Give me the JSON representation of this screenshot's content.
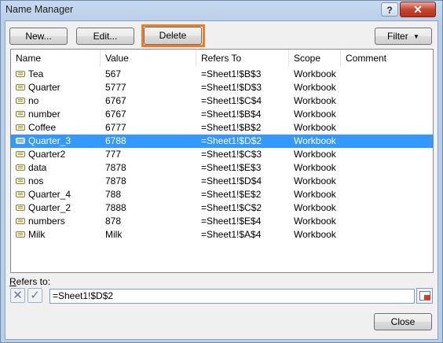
{
  "window": {
    "title": "Name Manager",
    "help_label": "?",
    "close_label": "✕"
  },
  "toolbar": {
    "new_label": "New...",
    "edit_label": "Edit...",
    "delete_label": "Delete",
    "filter_label": "Filter"
  },
  "columns": [
    "Name",
    "Value",
    "Refers To",
    "Scope",
    "Comment"
  ],
  "rows": [
    {
      "name": "Tea",
      "value": "567",
      "refers_to": "=Sheet1!$B$3",
      "scope": "Workbook",
      "comment": ""
    },
    {
      "name": "Quarter",
      "value": "5777",
      "refers_to": "=Sheet1!$D$3",
      "scope": "Workbook",
      "comment": ""
    },
    {
      "name": "no",
      "value": "6767",
      "refers_to": "=Sheet1!$C$4",
      "scope": "Workbook",
      "comment": ""
    },
    {
      "name": "number",
      "value": "6767",
      "refers_to": "=Sheet1!$B$4",
      "scope": "Workbook",
      "comment": ""
    },
    {
      "name": "Coffee",
      "value": "6777",
      "refers_to": "=Sheet1!$B$2",
      "scope": "Workbook",
      "comment": ""
    },
    {
      "name": "Quarter_3",
      "value": "6788",
      "refers_to": "=Sheet1!$D$2",
      "scope": "Workbook",
      "comment": "",
      "selected": true
    },
    {
      "name": "Quarter2",
      "value": "777",
      "refers_to": "=Sheet1!$C$3",
      "scope": "Workbook",
      "comment": ""
    },
    {
      "name": "data",
      "value": "7878",
      "refers_to": "=Sheet1!$E$3",
      "scope": "Workbook",
      "comment": ""
    },
    {
      "name": "nos",
      "value": "7878",
      "refers_to": "=Sheet1!$D$4",
      "scope": "Workbook",
      "comment": ""
    },
    {
      "name": "Quarter_4",
      "value": "788",
      "refers_to": "=Sheet1!$E$2",
      "scope": "Workbook",
      "comment": ""
    },
    {
      "name": "Quarter_2",
      "value": "7888",
      "refers_to": "=Sheet1!$C$2",
      "scope": "Workbook",
      "comment": ""
    },
    {
      "name": "numbers",
      "value": "878",
      "refers_to": "=Sheet1!$E$4",
      "scope": "Workbook",
      "comment": ""
    },
    {
      "name": "Milk",
      "value": "Milk",
      "refers_to": "=Sheet1!$A$4",
      "scope": "Workbook",
      "comment": ""
    }
  ],
  "refers_to": {
    "label": "Refers to:",
    "value": "=Sheet1!$D$2",
    "cancel_icon": "cancel-x-icon",
    "confirm_icon": "checkmark-icon"
  },
  "footer": {
    "close_label": "Close"
  },
  "colors": {
    "selection": "#3399ff",
    "highlight": "#f07d24"
  }
}
